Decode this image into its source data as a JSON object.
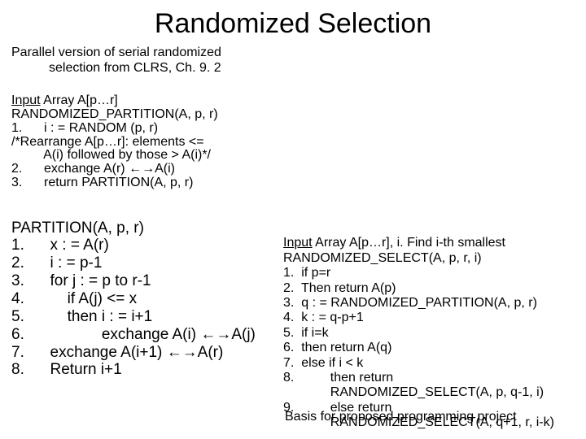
{
  "title": "Randomized Selection",
  "intro_line1": "Parallel version of serial randomized",
  "intro_line2": "selection from CLRS, Ch. 9. 2",
  "rp": {
    "input_prefix": "Input",
    "input_rest": " Array A[p…r]",
    "name": "RANDOMIZED_PARTITION(A, p, r)",
    "s1": "1.      i : = RANDOM (p, r)",
    "comment1": "/*Rearrange A[p…r]: elements <=",
    "comment2": "         A(i) followed by those > A(i)*/",
    "s2": "2.      exchange A(r) ←→A(i)",
    "s3": "3.      return PARTITION(A, p, r)"
  },
  "part": {
    "name": "PARTITION(A, p, r)",
    "s1": "1.      x : = A(r)",
    "s2": "2.      i : = p-1",
    "s3": "3.      for j : = p to r-1",
    "s4": "4.          if A(j) <= x",
    "s5": "5.          then i : = i+1",
    "s6": "6.                  exchange A(i) ←→A(j)",
    "s7": "7.      exchange A(i+1) ←→A(r)",
    "s8": "8.      Return i+1"
  },
  "sel": {
    "input_prefix": "Input",
    "input_rest": " Array A[p…r], i. Find i-th smallest",
    "name": "RANDOMIZED_SELECT(A, p, r, i)",
    "s1": "1.  if p=r",
    "s2": "2.  Then return A(p)",
    "s3": "3.  q : = RANDOMIZED_PARTITION(A, p, r)",
    "s4": "4.  k : = q-p+1",
    "s5": "5.  if i=k",
    "s6": "6.  then return A(q)",
    "s7": "7.  else if i < k",
    "s8": "8.          then return",
    "s8b": "             RANDOMIZED_SELECT(A, p, q-1, i)",
    "s9": "9.          else return",
    "s9b": "             RANDOMIZED_SELECT(A, q+1, r, i-k)"
  },
  "basis": "Basis for proposed programming project"
}
